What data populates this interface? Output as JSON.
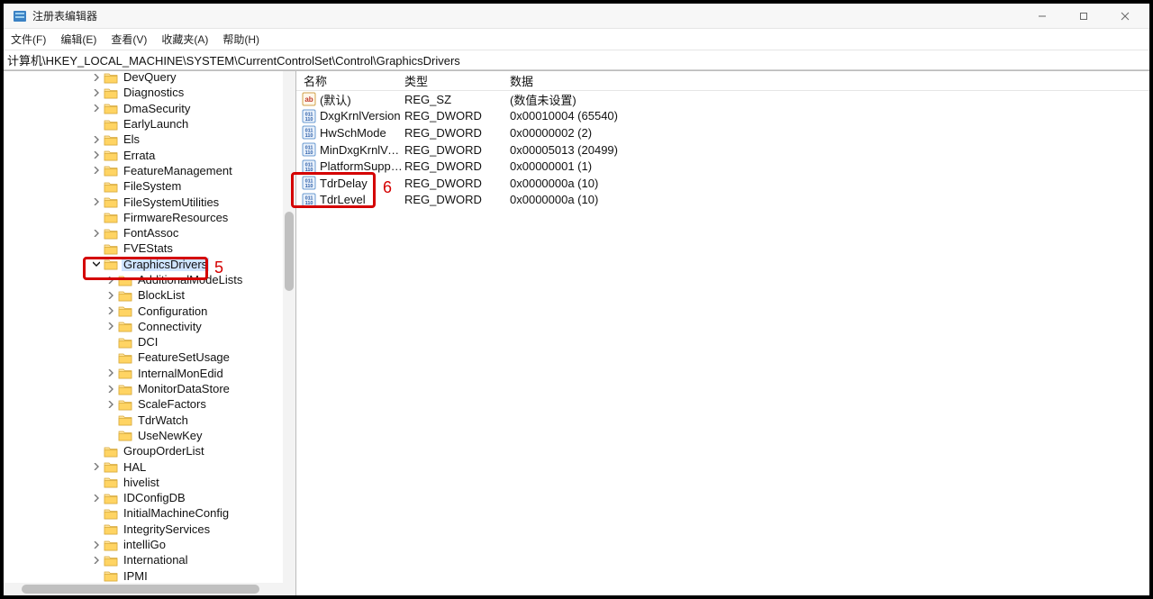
{
  "window": {
    "title": "注册表编辑器"
  },
  "menu": {
    "file": "文件(F)",
    "edit": "编辑(E)",
    "view": "查看(V)",
    "fav": "收藏夹(A)",
    "help": "帮助(H)"
  },
  "address": "计算机\\HKEY_LOCAL_MACHINE\\SYSTEM\\CurrentControlSet\\Control\\GraphicsDrivers",
  "treeItems": [
    {
      "indent": 6,
      "expand": "right",
      "label": "DevQuery"
    },
    {
      "indent": 6,
      "expand": "right",
      "label": "Diagnostics"
    },
    {
      "indent": 6,
      "expand": "right",
      "label": "DmaSecurity"
    },
    {
      "indent": 6,
      "expand": "none",
      "label": "EarlyLaunch"
    },
    {
      "indent": 6,
      "expand": "right",
      "label": "Els"
    },
    {
      "indent": 6,
      "expand": "right",
      "label": "Errata"
    },
    {
      "indent": 6,
      "expand": "right",
      "label": "FeatureManagement"
    },
    {
      "indent": 6,
      "expand": "none",
      "label": "FileSystem"
    },
    {
      "indent": 6,
      "expand": "right",
      "label": "FileSystemUtilities"
    },
    {
      "indent": 6,
      "expand": "none",
      "label": "FirmwareResources"
    },
    {
      "indent": 6,
      "expand": "right",
      "label": "FontAssoc"
    },
    {
      "indent": 6,
      "expand": "none",
      "label": "FVEStats"
    },
    {
      "indent": 6,
      "expand": "down",
      "label": "GraphicsDrivers",
      "selected": true
    },
    {
      "indent": 7,
      "expand": "right",
      "label": "AdditionalModeLists"
    },
    {
      "indent": 7,
      "expand": "right",
      "label": "BlockList"
    },
    {
      "indent": 7,
      "expand": "right",
      "label": "Configuration"
    },
    {
      "indent": 7,
      "expand": "right",
      "label": "Connectivity"
    },
    {
      "indent": 7,
      "expand": "none",
      "label": "DCI"
    },
    {
      "indent": 7,
      "expand": "none",
      "label": "FeatureSetUsage"
    },
    {
      "indent": 7,
      "expand": "right",
      "label": "InternalMonEdid"
    },
    {
      "indent": 7,
      "expand": "right",
      "label": "MonitorDataStore"
    },
    {
      "indent": 7,
      "expand": "right",
      "label": "ScaleFactors"
    },
    {
      "indent": 7,
      "expand": "none",
      "label": "TdrWatch"
    },
    {
      "indent": 7,
      "expand": "none",
      "label": "UseNewKey"
    },
    {
      "indent": 6,
      "expand": "none",
      "label": "GroupOrderList"
    },
    {
      "indent": 6,
      "expand": "right",
      "label": "HAL"
    },
    {
      "indent": 6,
      "expand": "none",
      "label": "hivelist"
    },
    {
      "indent": 6,
      "expand": "right",
      "label": "IDConfigDB"
    },
    {
      "indent": 6,
      "expand": "none",
      "label": "InitialMachineConfig"
    },
    {
      "indent": 6,
      "expand": "none",
      "label": "IntegrityServices"
    },
    {
      "indent": 6,
      "expand": "right",
      "label": "intelliGo"
    },
    {
      "indent": 6,
      "expand": "right",
      "label": "International"
    },
    {
      "indent": 6,
      "expand": "none",
      "label": "IPMI"
    }
  ],
  "annotations": {
    "tree": "5",
    "values": "6"
  },
  "columns": {
    "name": "名称",
    "type": "类型",
    "data": "数据"
  },
  "values": [
    {
      "icon": "sz",
      "name": "(默认)",
      "type": "REG_SZ",
      "data": "(数值未设置)"
    },
    {
      "icon": "dword",
      "name": "DxgKrnlVersion",
      "type": "REG_DWORD",
      "data": "0x00010004 (65540)"
    },
    {
      "icon": "dword",
      "name": "HwSchMode",
      "type": "REG_DWORD",
      "data": "0x00000002 (2)"
    },
    {
      "icon": "dword",
      "name": "MinDxgKrnlVer...",
      "type": "REG_DWORD",
      "data": "0x00005013 (20499)"
    },
    {
      "icon": "dword",
      "name": "PlatformSuppo...",
      "type": "REG_DWORD",
      "data": "0x00000001 (1)"
    },
    {
      "icon": "dword",
      "name": "TdrDelay",
      "type": "REG_DWORD",
      "data": "0x0000000a (10)"
    },
    {
      "icon": "dword",
      "name": "TdrLevel",
      "type": "REG_DWORD",
      "data": "0x0000000a (10)"
    }
  ]
}
